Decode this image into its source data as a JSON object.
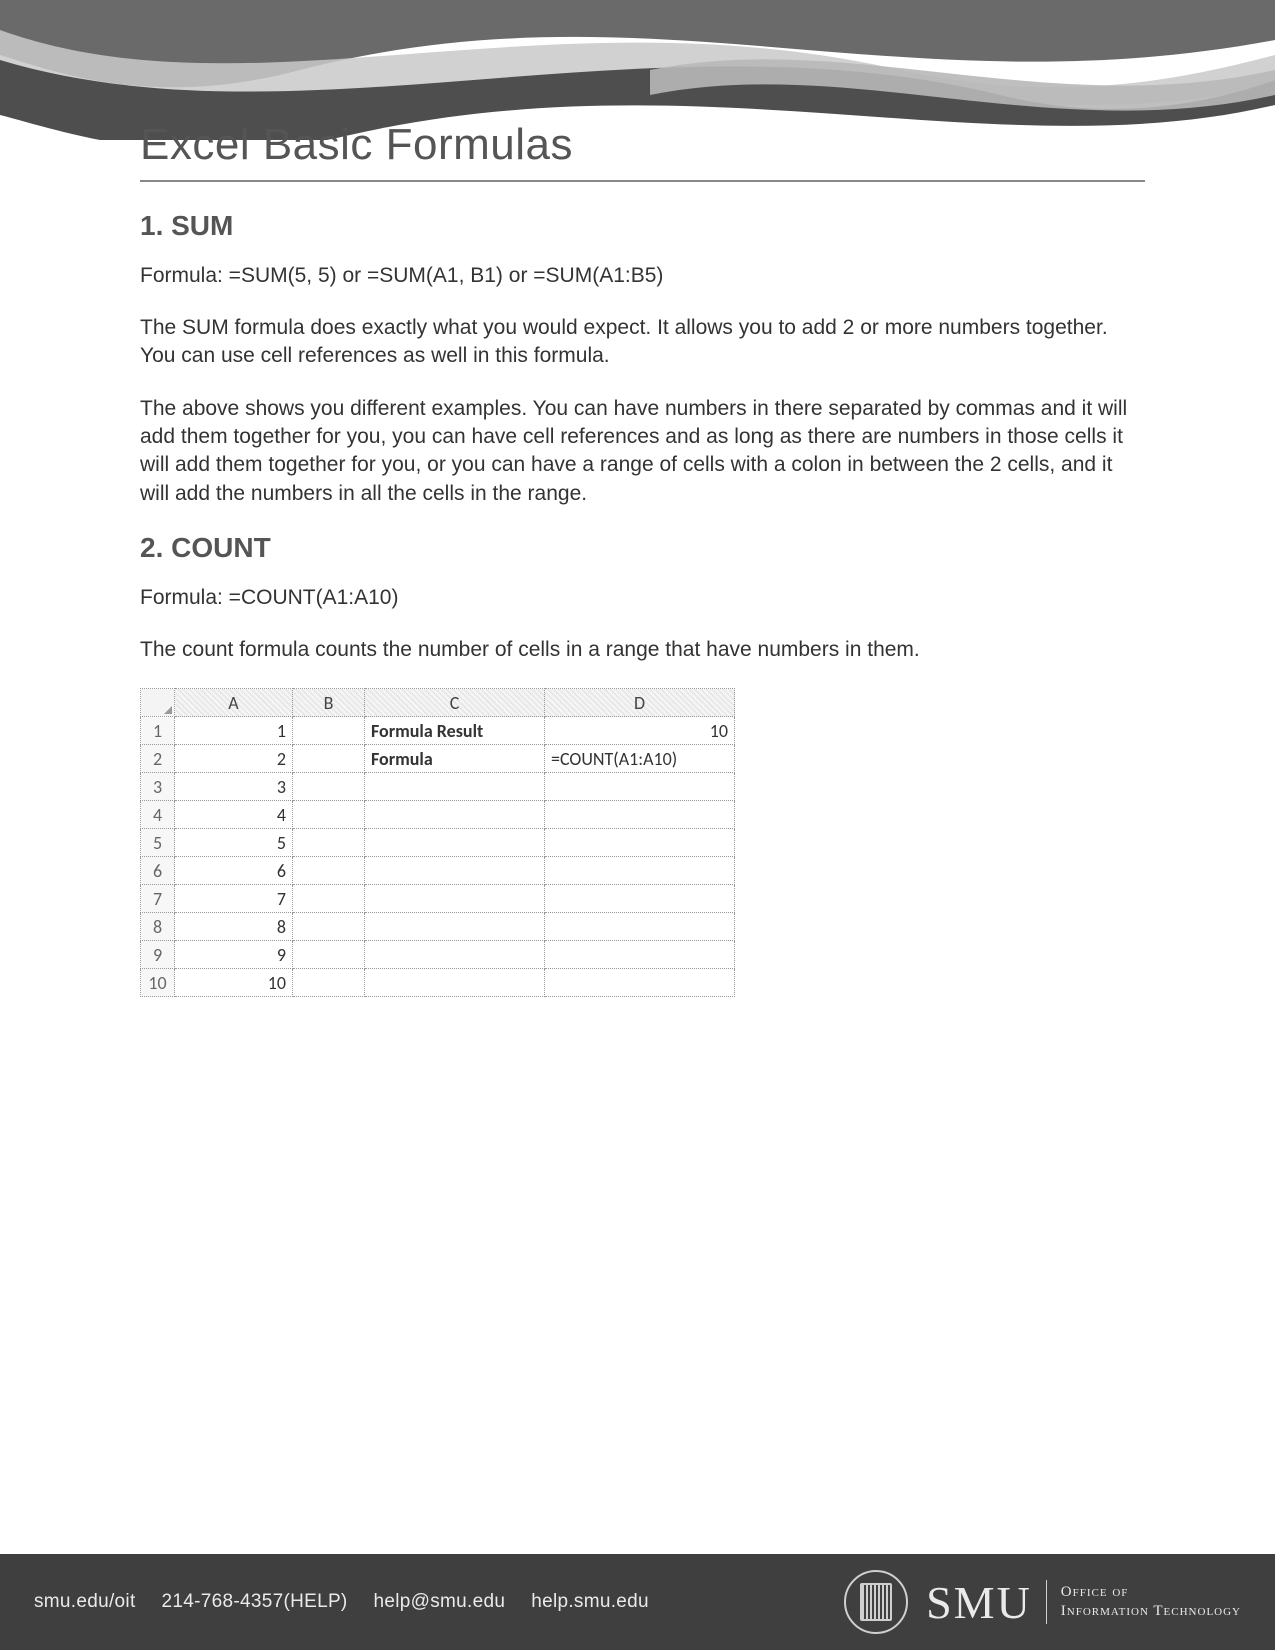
{
  "title": "Excel Basic Formulas",
  "sections": {
    "sum": {
      "heading": "1. SUM",
      "formula_line": "Formula: =SUM(5, 5) or =SUM(A1, B1) or =SUM(A1:B5)",
      "para1": "The SUM formula does exactly what you would expect. It allows you to add 2 or more numbers together. You can use cell references as well in this formula.",
      "para2": "The above shows you different examples. You can have numbers in there separated by commas and it will add them together for you, you can have cell references and as long as there are numbers in those cells it will add them together for you, or you can have a range of cells with a colon in between the 2 cells, and it will add the numbers in all the cells in the range."
    },
    "count": {
      "heading": "2. COUNT",
      "formula_line": "Formula: =COUNT(A1:A10)",
      "para1": "The count formula counts the number of cells in a range that have numbers in them."
    }
  },
  "spreadsheet": {
    "columns": [
      "A",
      "B",
      "C",
      "D"
    ],
    "rows": [
      {
        "n": "1",
        "A": "1",
        "B": "",
        "C": "Formula Result",
        "D": "10",
        "Cbold": true,
        "Dalign": "right"
      },
      {
        "n": "2",
        "A": "2",
        "B": "",
        "C": "Formula",
        "D": "=COUNT(A1:A10)",
        "Cbold": true,
        "Dalign": "left"
      },
      {
        "n": "3",
        "A": "3",
        "B": "",
        "C": "",
        "D": ""
      },
      {
        "n": "4",
        "A": "4",
        "B": "",
        "C": "",
        "D": ""
      },
      {
        "n": "5",
        "A": "5",
        "B": "",
        "C": "",
        "D": ""
      },
      {
        "n": "6",
        "A": "6",
        "B": "",
        "C": "",
        "D": ""
      },
      {
        "n": "7",
        "A": "7",
        "B": "",
        "C": "",
        "D": ""
      },
      {
        "n": "8",
        "A": "8",
        "B": "",
        "C": "",
        "D": ""
      },
      {
        "n": "9",
        "A": "9",
        "B": "",
        "C": "",
        "D": ""
      },
      {
        "n": "10",
        "A": "10",
        "B": "",
        "C": "",
        "D": ""
      }
    ]
  },
  "footer": {
    "items": [
      "smu.edu/oit",
      "214-768-4357(HELP)",
      "help@smu.edu",
      "help.smu.edu"
    ],
    "brand": "SMU",
    "brand_sub1": "Office of",
    "brand_sub2": "Information Technology"
  }
}
